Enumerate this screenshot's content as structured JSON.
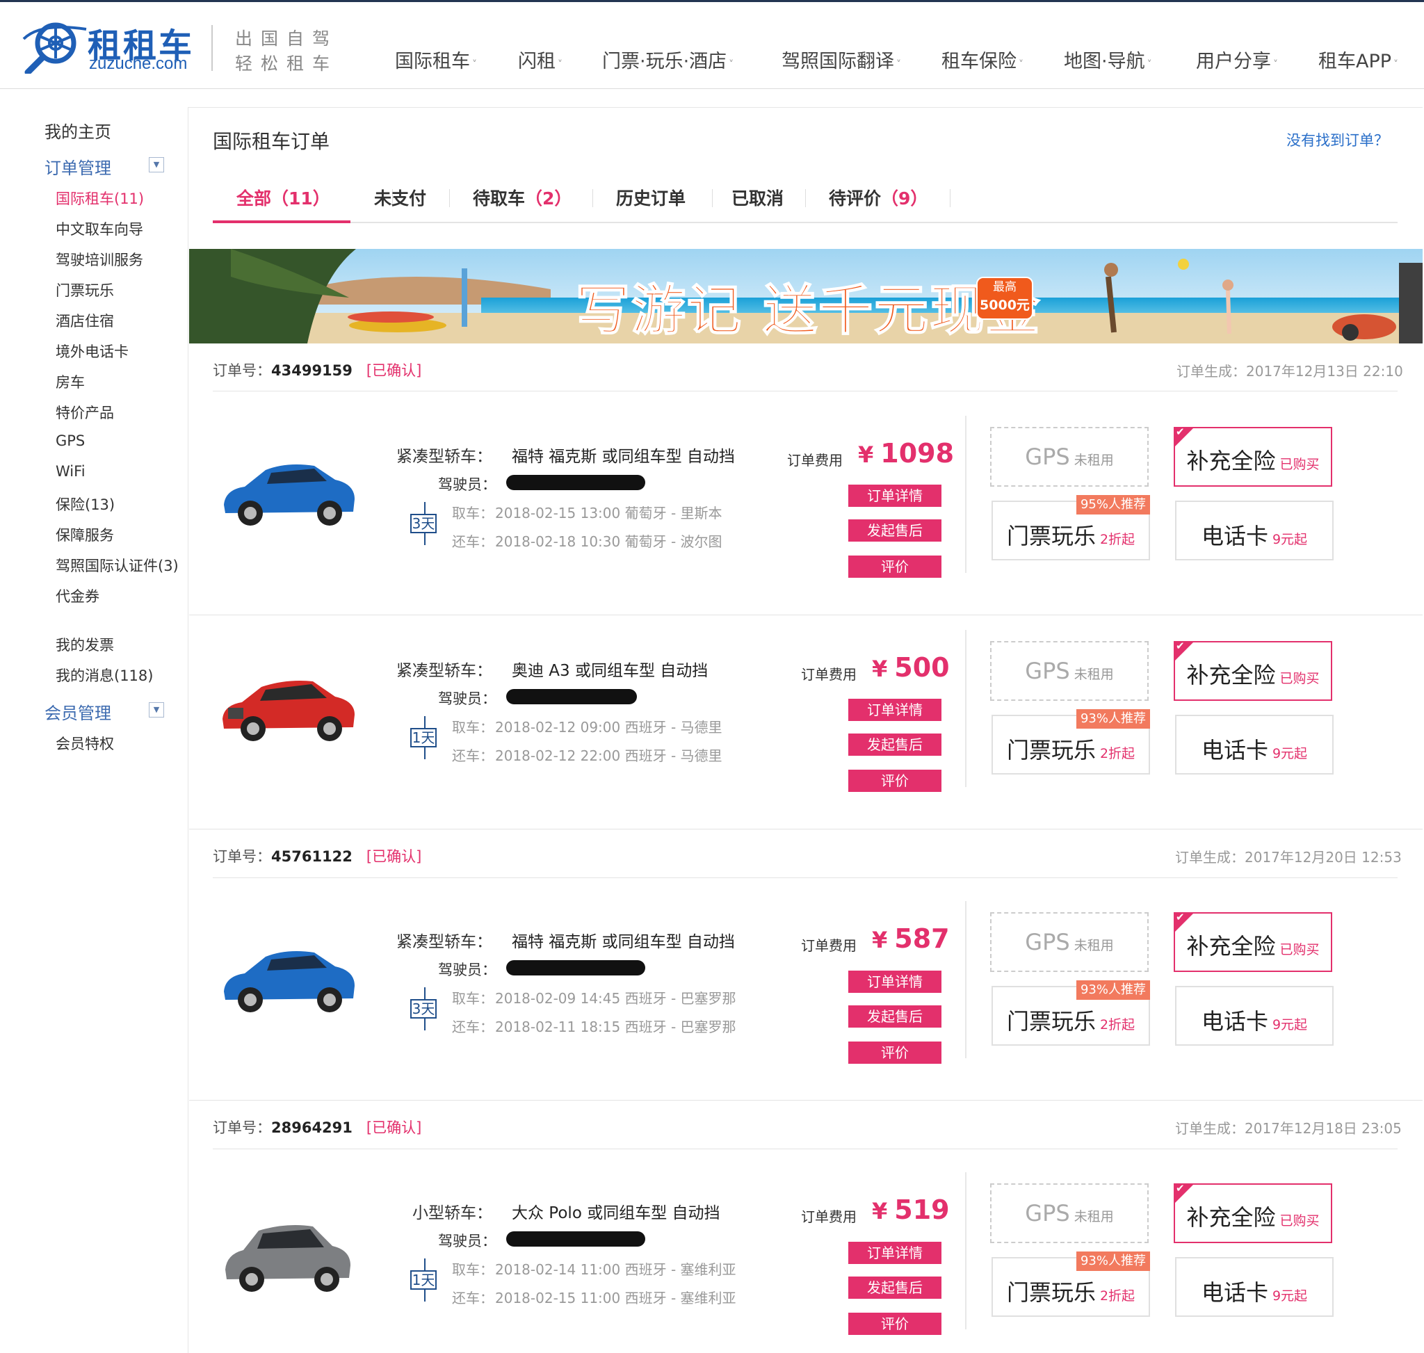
{
  "header": {
    "logo_cn": "租租车",
    "logo_en": "zuzuche.com",
    "slogan_line1": "出国自驾",
    "slogan_line2": "轻松租车",
    "nav": [
      "国际租车",
      "闪租",
      "门票·玩乐·酒店",
      "驾照国际翻译",
      "租车保险",
      "地图·导航",
      "用户分享",
      "租车APP"
    ]
  },
  "sidebar": {
    "home": "我的主页",
    "order_mgmt": "订单管理",
    "order_items": [
      "国际租车(11)",
      "中文取车向导",
      "驾驶培训服务",
      "门票玩乐",
      "酒店住宿",
      "境外电话卡",
      "房车",
      "特价产品",
      "GPS",
      "WiFi",
      "保险(13)",
      "保障服务",
      "驾照国际认证件(3)",
      "代金券"
    ],
    "extra_items": [
      "我的发票",
      "我的消息(118)"
    ],
    "member_mgmt": "会员管理",
    "member_items": [
      "会员特权"
    ]
  },
  "main": {
    "title": "国际租车订单",
    "not_found": "没有找到订单？",
    "tabs": [
      {
        "label": "全部",
        "count": "（11）"
      },
      {
        "label": "未支付",
        "count": ""
      },
      {
        "label": "待取车",
        "count": "（2）"
      },
      {
        "label": "历史订单",
        "count": ""
      },
      {
        "label": "已取消",
        "count": ""
      },
      {
        "label": "待评价",
        "count": "（9）"
      }
    ]
  },
  "banner": {
    "headline": "写游记 送千元现金",
    "badge_line1": "最高",
    "badge_line2": "5000元"
  },
  "labels": {
    "order_no": "订单号：",
    "created": "订单生成：",
    "driver": "驾驶员：",
    "pickup": "取车：",
    "return": "还车：",
    "fee": "订单费用",
    "currency": "¥",
    "btn_detail": "订单详情",
    "btn_after": "发起售后",
    "btn_review": "评价",
    "gps": "GPS",
    "gps_status": "未租用",
    "ins": "补充全险",
    "ins_status": "已购买",
    "ticket": "门票玩乐",
    "ticket_sub": "2折起",
    "phone": "电话卡",
    "phone_sub": "9元起"
  },
  "colors": {
    "accent": "#e3306c",
    "brand": "#1f5fb6",
    "days_box": "#1f4e8a"
  },
  "orders": [
    {
      "no": "43499159",
      "status": "[已确认]",
      "created": "2017年12月13日 22:10",
      "class": "紧凑型轿车：",
      "model": "福特 福克斯 或同组车型 自动挡",
      "days": "3天",
      "pickup": "2018-02-15 13:00 葡萄牙 - 里斯本",
      "return": "2018-02-18 10:30 葡萄牙 - 波尔图",
      "price": "1098",
      "recommend": "95%人推荐"
    },
    {
      "no": "",
      "status": "",
      "created": "",
      "class": "紧凑型轿车：",
      "model": "奥迪 A3 或同组车型 自动挡",
      "days": "1天",
      "pickup": "2018-02-12 09:00 西班牙 - 马德里",
      "return": "2018-02-12 22:00 西班牙 - 马德里",
      "price": "500",
      "recommend": "93%人推荐"
    },
    {
      "no": "45761122",
      "status": "[已确认]",
      "created": "2017年12月20日 12:53",
      "class": "紧凑型轿车：",
      "model": "福特 福克斯 或同组车型 自动挡",
      "days": "3天",
      "pickup": "2018-02-09 14:45 西班牙 - 巴塞罗那",
      "return": "2018-02-11 18:15 西班牙 - 巴塞罗那",
      "price": "587",
      "recommend": "93%人推荐"
    },
    {
      "no": "28964291",
      "status": "[已确认]",
      "created": "2017年12月18日 23:05",
      "class": "小型轿车：",
      "model": "大众 Polo 或同组车型 自动挡",
      "days": "1天",
      "pickup": "2018-02-14 11:00 西班牙 - 塞维利亚",
      "return": "2018-02-15 11:00 西班牙 - 塞维利亚",
      "price": "519",
      "recommend": "93%人推荐"
    }
  ]
}
